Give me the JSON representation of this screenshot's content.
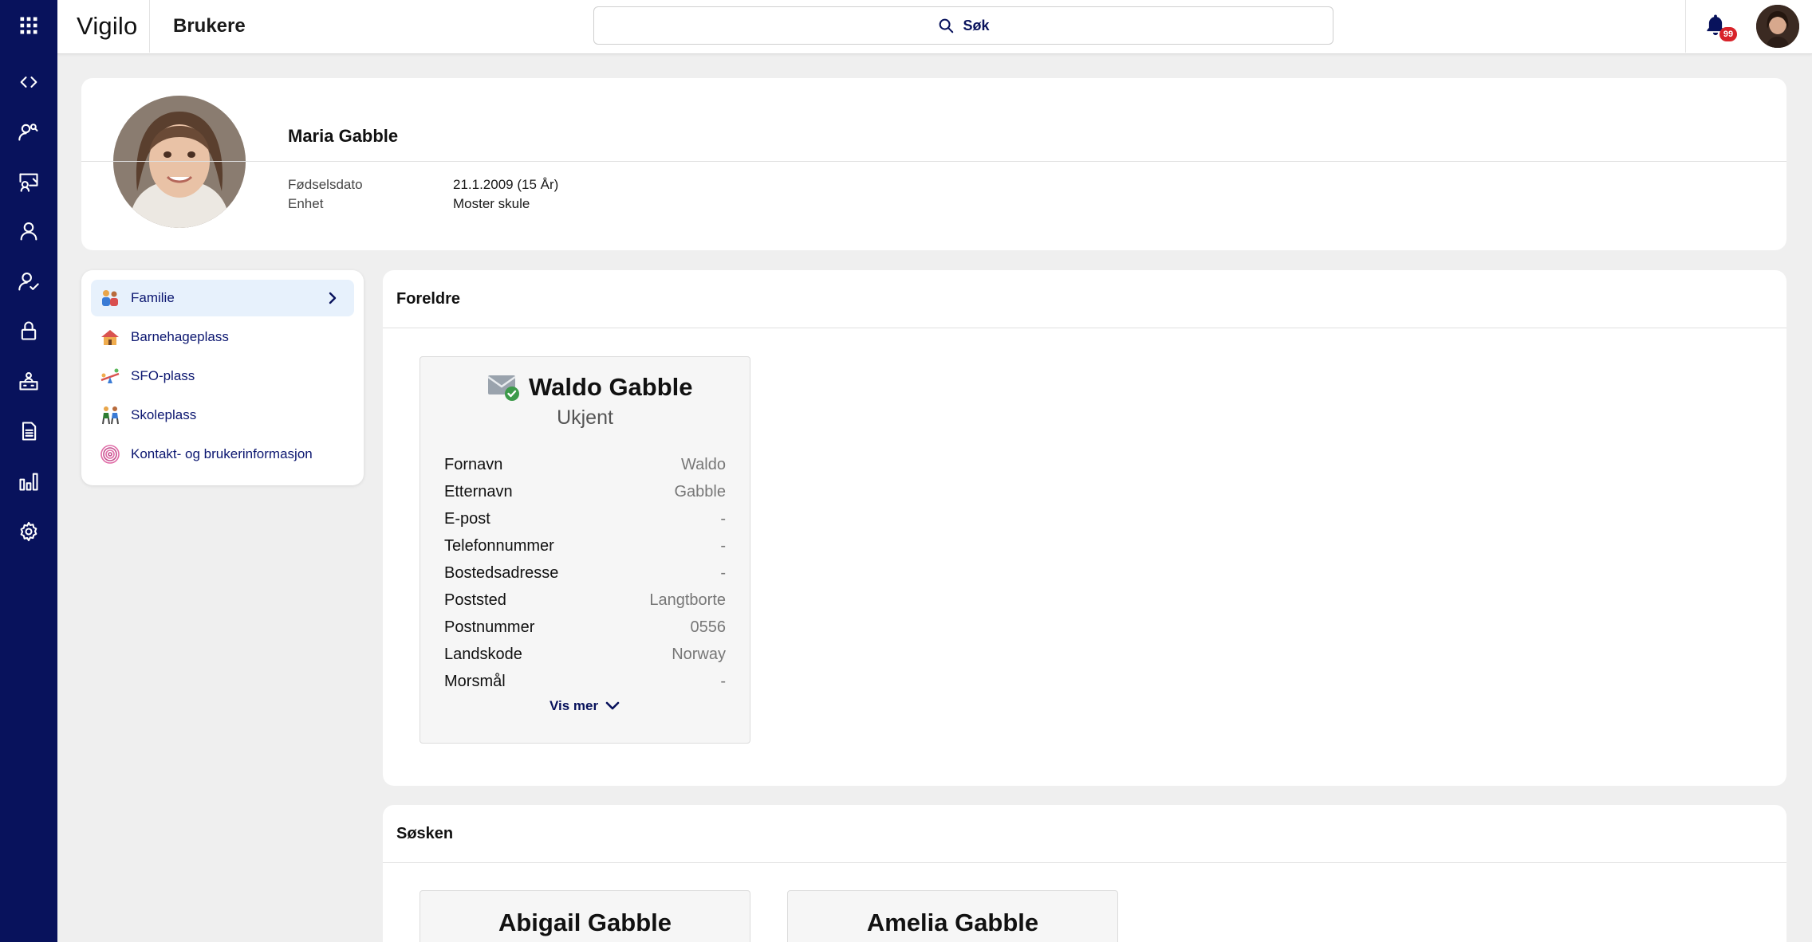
{
  "header": {
    "brand": "Vigilo",
    "title": "Brukere",
    "search_label": "Søk",
    "notification_count": "99"
  },
  "sidebar": {
    "icons": [
      "grid-icon",
      "code-icon",
      "users-search-icon",
      "screen-user-icon",
      "user-icon",
      "user-check-icon",
      "lock-icon",
      "building-user-icon",
      "document-icon",
      "bar-chart-icon",
      "gear-icon"
    ]
  },
  "profile": {
    "name": "Maria Gabble",
    "fields": [
      {
        "label": "Fødselsdato",
        "value": "21.1.2009 (15 År)"
      },
      {
        "label": "Enhet",
        "value": "Moster skule"
      }
    ]
  },
  "menu": {
    "items": [
      {
        "label": "Familie",
        "active": true
      },
      {
        "label": "Barnehageplass"
      },
      {
        "label": "SFO-plass"
      },
      {
        "label": "Skoleplass"
      },
      {
        "label": "Kontakt- og brukerinformasjon"
      }
    ]
  },
  "parents_section": {
    "title": "Foreldre",
    "parent": {
      "name": "Waldo Gabble",
      "status": "Ukjent",
      "fields": [
        {
          "label": "Fornavn",
          "value": "Waldo"
        },
        {
          "label": "Etternavn",
          "value": "Gabble"
        },
        {
          "label": "E-post",
          "value": "-"
        },
        {
          "label": "Telefonnummer",
          "value": "-"
        },
        {
          "label": "Bostedsadresse",
          "value": "-"
        },
        {
          "label": "Poststed",
          "value": "Langtborte"
        },
        {
          "label": "Postnummer",
          "value": "0556"
        },
        {
          "label": "Landskode",
          "value": "Norway"
        },
        {
          "label": "Morsmål",
          "value": "-"
        }
      ],
      "show_more": "Vis mer"
    }
  },
  "siblings_section": {
    "title": "Søsken",
    "siblings": [
      {
        "name": "Abigail Gabble"
      },
      {
        "name": "Amelia Gabble"
      }
    ]
  }
}
